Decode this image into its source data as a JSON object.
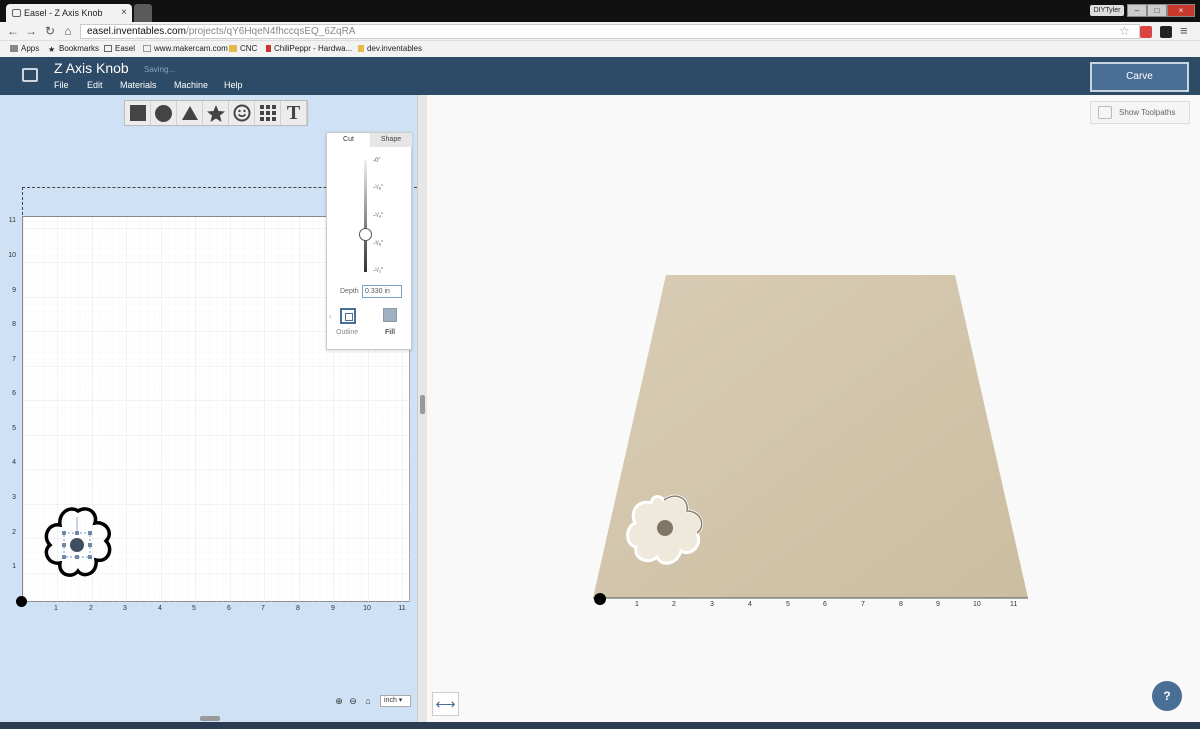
{
  "browser": {
    "tab_title": "Easel - Z Axis Knob",
    "tab_close": "×",
    "user_badge": "DIYTyler",
    "url_host": "easel.inventables.com",
    "url_path": "/projects/qY6HqeN4fhccqsEQ_6ZqRA",
    "bookmarks": [
      "Apps",
      "Bookmarks",
      "Easel",
      "www.makercam.com",
      "CNC",
      "ChiliPeppr - Hardwa...",
      "dev.inventables"
    ]
  },
  "app": {
    "project_title": "Z Axis Knob",
    "saving_status": "Saving...",
    "menus": [
      "File",
      "Edit",
      "Materials",
      "Machine",
      "Help"
    ],
    "carve_label": "Carve",
    "accent_color": "#2d4a66"
  },
  "toolbar": {
    "tools": [
      "square-tool",
      "circle-tool",
      "triangle-tool",
      "star-tool",
      "smiley-tool",
      "grid-tool",
      "text-tool"
    ],
    "text_tool_label": "T"
  },
  "design": {
    "y_ticks": [
      "11",
      "10",
      "9",
      "8",
      "7",
      "6",
      "5",
      "4",
      "3",
      "2",
      "1"
    ],
    "x_ticks": [
      "1",
      "2",
      "3",
      "4",
      "5",
      "6",
      "7",
      "8",
      "9",
      "10",
      "11"
    ],
    "unit": "inch",
    "unit_caret": "▾"
  },
  "cut_panel": {
    "tabs": [
      "Cut",
      "Shape"
    ],
    "depth_ticks": [
      "-0\"",
      "-¹/₈\"",
      "-¹/₄\"",
      "-³/₈\"",
      "-¹/₂\""
    ],
    "depth_label": "Depth",
    "depth_value": "0.330 in",
    "outline_label": "Outline",
    "fill_label": "Fill",
    "selected": "Fill"
  },
  "preview": {
    "show_toolpaths_label": "Show Toolpaths",
    "x_ticks": [
      "1",
      "2",
      "3",
      "4",
      "5",
      "6",
      "7",
      "8",
      "9",
      "10",
      "11"
    ],
    "help_label": "?",
    "toggle_label": "⟷"
  }
}
